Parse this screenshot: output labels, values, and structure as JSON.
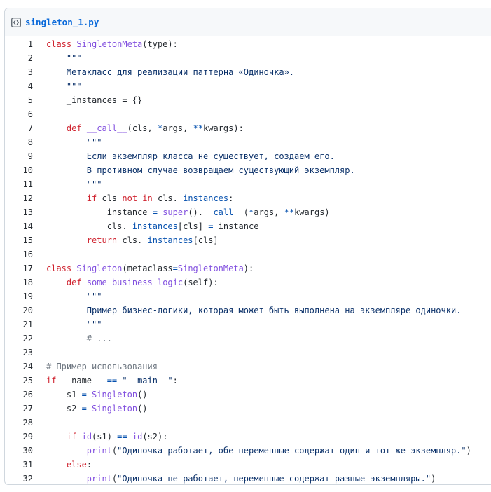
{
  "file": {
    "name": "singleton_1.py",
    "icon": "code-file-icon"
  },
  "colors": {
    "keyword": "#cf222e",
    "function": "#8250df",
    "string": "#0a3069",
    "comment": "#6e7781",
    "operator": "#0550ae",
    "plain": "#24292f",
    "link": "#0969da"
  },
  "lines": [
    {
      "n": "1",
      "tokens": [
        [
          "k",
          "class"
        ],
        [
          "p",
          " "
        ],
        [
          "f",
          "SingletonMeta"
        ],
        [
          "p",
          "(type):"
        ]
      ]
    },
    {
      "n": "2",
      "tokens": [
        [
          "s",
          "    \"\"\""
        ]
      ]
    },
    {
      "n": "3",
      "tokens": [
        [
          "s",
          "    Метакласс для реализации паттерна «Одиночка»."
        ]
      ]
    },
    {
      "n": "4",
      "tokens": [
        [
          "s",
          "    \"\"\""
        ]
      ]
    },
    {
      "n": "5",
      "tokens": [
        [
          "p",
          "    _instances = {}"
        ]
      ]
    },
    {
      "n": "6",
      "tokens": [
        [
          "p",
          ""
        ]
      ]
    },
    {
      "n": "7",
      "tokens": [
        [
          "p",
          "    "
        ],
        [
          "k",
          "def"
        ],
        [
          "p",
          " "
        ],
        [
          "f",
          "__call__"
        ],
        [
          "p",
          "(cls, "
        ],
        [
          "o",
          "*"
        ],
        [
          "p",
          "args, "
        ],
        [
          "o",
          "**"
        ],
        [
          "p",
          "kwargs):"
        ]
      ]
    },
    {
      "n": "8",
      "tokens": [
        [
          "s",
          "        \"\"\""
        ]
      ]
    },
    {
      "n": "9",
      "tokens": [
        [
          "s",
          "        Если экземпляр класса не существует, создаем его."
        ]
      ]
    },
    {
      "n": "10",
      "tokens": [
        [
          "s",
          "        В противном случае возвращаем существующий экземпляр."
        ]
      ]
    },
    {
      "n": "11",
      "tokens": [
        [
          "s",
          "        \"\"\""
        ]
      ]
    },
    {
      "n": "12",
      "tokens": [
        [
          "p",
          "        "
        ],
        [
          "k",
          "if"
        ],
        [
          "p",
          " cls "
        ],
        [
          "k",
          "not"
        ],
        [
          "p",
          " "
        ],
        [
          "k",
          "in"
        ],
        [
          "p",
          " cls."
        ],
        [
          "o",
          "_instances"
        ],
        [
          "p",
          ":"
        ]
      ]
    },
    {
      "n": "13",
      "tokens": [
        [
          "p",
          "            instance "
        ],
        [
          "o",
          "="
        ],
        [
          "p",
          " "
        ],
        [
          "f",
          "super"
        ],
        [
          "p",
          "()."
        ],
        [
          "o",
          "__call__"
        ],
        [
          "p",
          "("
        ],
        [
          "o",
          "*"
        ],
        [
          "p",
          "args, "
        ],
        [
          "o",
          "**"
        ],
        [
          "p",
          "kwargs)"
        ]
      ]
    },
    {
      "n": "14",
      "tokens": [
        [
          "p",
          "            cls."
        ],
        [
          "o",
          "_instances"
        ],
        [
          "p",
          "[cls] "
        ],
        [
          "o",
          "="
        ],
        [
          "p",
          " instance"
        ]
      ]
    },
    {
      "n": "15",
      "tokens": [
        [
          "p",
          "        "
        ],
        [
          "k",
          "return"
        ],
        [
          "p",
          " cls."
        ],
        [
          "o",
          "_instances"
        ],
        [
          "p",
          "[cls]"
        ]
      ]
    },
    {
      "n": "16",
      "tokens": [
        [
          "p",
          ""
        ]
      ]
    },
    {
      "n": "17",
      "tokens": [
        [
          "k",
          "class"
        ],
        [
          "p",
          " "
        ],
        [
          "f",
          "Singleton"
        ],
        [
          "p",
          "(metaclass"
        ],
        [
          "o",
          "="
        ],
        [
          "f",
          "SingletonMeta"
        ],
        [
          "p",
          "):"
        ]
      ]
    },
    {
      "n": "18",
      "tokens": [
        [
          "p",
          "    "
        ],
        [
          "k",
          "def"
        ],
        [
          "p",
          " "
        ],
        [
          "f",
          "some_business_logic"
        ],
        [
          "p",
          "(self):"
        ]
      ]
    },
    {
      "n": "19",
      "tokens": [
        [
          "s",
          "        \"\"\""
        ]
      ]
    },
    {
      "n": "20",
      "tokens": [
        [
          "s",
          "        Пример бизнес-логики, которая может быть выполнена на экземпляре одиночки."
        ]
      ]
    },
    {
      "n": "21",
      "tokens": [
        [
          "s",
          "        \"\"\""
        ]
      ]
    },
    {
      "n": "22",
      "tokens": [
        [
          "c",
          "        # ..."
        ]
      ]
    },
    {
      "n": "23",
      "tokens": [
        [
          "p",
          ""
        ]
      ]
    },
    {
      "n": "24",
      "tokens": [
        [
          "c",
          "# Пример использования"
        ]
      ]
    },
    {
      "n": "25",
      "tokens": [
        [
          "k",
          "if"
        ],
        [
          "p",
          " __name__ "
        ],
        [
          "o",
          "=="
        ],
        [
          "p",
          " "
        ],
        [
          "s",
          "\"__main__\""
        ],
        [
          "p",
          ":"
        ]
      ]
    },
    {
      "n": "26",
      "tokens": [
        [
          "p",
          "    s1 "
        ],
        [
          "o",
          "="
        ],
        [
          "p",
          " "
        ],
        [
          "f",
          "Singleton"
        ],
        [
          "p",
          "()"
        ]
      ]
    },
    {
      "n": "27",
      "tokens": [
        [
          "p",
          "    s2 "
        ],
        [
          "o",
          "="
        ],
        [
          "p",
          " "
        ],
        [
          "f",
          "Singleton"
        ],
        [
          "p",
          "()"
        ]
      ]
    },
    {
      "n": "28",
      "tokens": [
        [
          "p",
          ""
        ]
      ]
    },
    {
      "n": "29",
      "tokens": [
        [
          "p",
          "    "
        ],
        [
          "k",
          "if"
        ],
        [
          "p",
          " "
        ],
        [
          "f",
          "id"
        ],
        [
          "p",
          "(s1) "
        ],
        [
          "o",
          "=="
        ],
        [
          "p",
          " "
        ],
        [
          "f",
          "id"
        ],
        [
          "p",
          "(s2):"
        ]
      ]
    },
    {
      "n": "30",
      "tokens": [
        [
          "p",
          "        "
        ],
        [
          "f",
          "print"
        ],
        [
          "p",
          "("
        ],
        [
          "s",
          "\"Одиночка работает, обе переменные содержат один и тот же экземпляр.\""
        ],
        [
          "p",
          ")"
        ]
      ]
    },
    {
      "n": "31",
      "tokens": [
        [
          "p",
          "    "
        ],
        [
          "k",
          "else"
        ],
        [
          "p",
          ":"
        ]
      ]
    },
    {
      "n": "32",
      "tokens": [
        [
          "p",
          "        "
        ],
        [
          "f",
          "print"
        ],
        [
          "p",
          "("
        ],
        [
          "s",
          "\"Одиночка не работает, переменные содержат разные экземпляры.\""
        ],
        [
          "p",
          ")"
        ]
      ]
    }
  ]
}
